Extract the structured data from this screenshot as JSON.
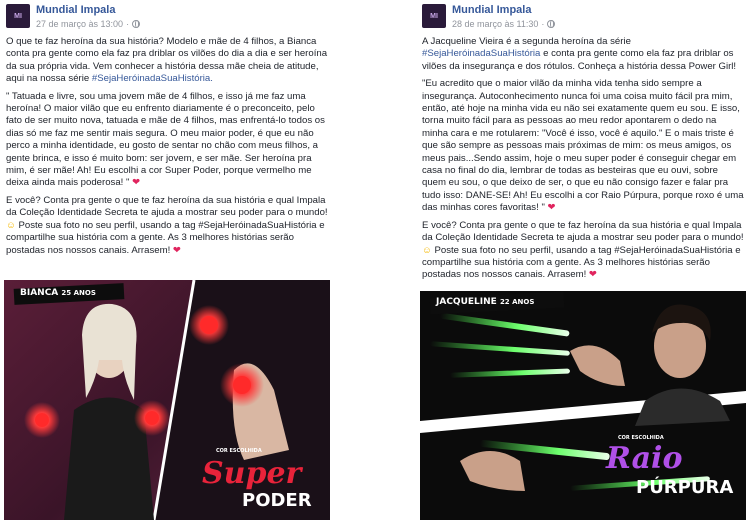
{
  "left_post": {
    "page_name": "Mundial Impala",
    "timestamp": "27 de março às 13:00",
    "avatar_text": "MI",
    "paragraphs": [
      "O que te faz heroína da sua história? Modelo e mãe de 4 filhos, a Bianca conta pra gente como ela faz pra driblar os vilões do dia a dia e ser heroína da sua própria vida. Vem conhecer a história dessa mãe cheia de atitude, aqui na nossa série",
      "\" Tatuada e livre, sou uma jovem mãe de 4 filhos, e isso já me faz uma heroína! O maior vilão que eu enfrento diariamente é o preconceito, pelo fato de ser muito nova, tatuada e mãe de 4 filhos, mas enfrentá-lo todos os dias só me faz me sentir mais segura. O meu maior poder, é que eu não perco a minha identidade, eu gosto de sentar no chão com meus filhos, a gente brinca, e isso é muito bom: ser jovem, e ser mãe. Ser heroína pra mim, é ser mãe! Ah! Eu escolhi a cor Super Poder, porque vermelho me deixa ainda mais poderosa! \"",
      "E você? Conta pra gente o que te faz heroína da sua história e qual Impala da Coleção Identidade Secreta te ajuda a mostrar seu poder para o mundo!",
      "Poste sua foto no seu perfil, usando a tag #SejaHeróinadaSuaHistória e compartilhe sua história com a gente. As 3 melhores histórias serão postadas nos nossos canais. Arrasem!"
    ],
    "hashtag_link": "#SejaHeróinadaSuaHistória.",
    "photo": {
      "name_tag": "BIANCA",
      "age_tag": "25 ANOS",
      "small_caption": "COR ESCOLHIDA",
      "product_title_1": "Super",
      "product_title_2": "PODER"
    }
  },
  "right_post": {
    "page_name": "Mundial Impala",
    "timestamp": "28 de março às 11:30",
    "avatar_text": "MI",
    "intro_1": "A Jacqueline Vieira é a segunda heroína da série",
    "intro_hashtag": "#SejaHeróinadaSuaHistória",
    "intro_2": "e conta pra gente como ela faz pra driblar os vilões da insegurança e dos rótulos. Conheça a história dessa Power Girl!",
    "quote": "\"Eu acredito que o maior vilão da minha vida tenha sido sempre a insegurança. Autoconhecimento nunca foi uma coisa muito fácil pra mim, então, até hoje na minha vida eu não sei exatamente quem eu sou. E isso, torna muito fácil para as pessoas ao meu redor apontarem o dedo na minha cara e me rotularem: \"Você é isso, você é aquilo.\" E o mais triste é que são sempre as pessoas mais próximas de mim: os meus amigos, os meus pais...Sendo assim, hoje o meu super poder é conseguir chegar em casa no final do dia, lembrar de todas as besteiras que eu ouvi, sobre quem eu sou, o que deixo de ser, o que eu não consigo fazer e falar pra tudo isso: DANE-SE! Ah! Eu escolhi a cor Raio Púrpura, porque roxo é uma das minhas cores favoritas! \"",
    "cta_1": "E você? Conta pra gente o que te faz heroína da sua história e qual Impala da Coleção Identidade Secreta te ajuda a mostrar seu poder para o mundo!",
    "cta_2": "Poste sua foto no seu perfil, usando a tag #SejaHeróinadaSuaHistória e compartilhe sua história com a gente. As 3 melhores histórias serão postadas nos nossos canais. Arrasem!",
    "photo": {
      "name_tag": "JACQUELINE",
      "age_tag": "22 ANOS",
      "small_caption": "COR ESCOLHIDA",
      "product_title_1": "Raio",
      "product_title_2": "PÚRPURA"
    }
  },
  "icons": {
    "privacy": "globe-icon",
    "heart": "heart-icon",
    "emoji": "smile-emoji-icon"
  },
  "colors": {
    "link": "#365899",
    "meta": "#90949c",
    "heart": "#e0245e",
    "super_poder_red": "#e8233a",
    "raio_purpura_purple": "#8a2be2",
    "green_light": "#4dff4d"
  }
}
